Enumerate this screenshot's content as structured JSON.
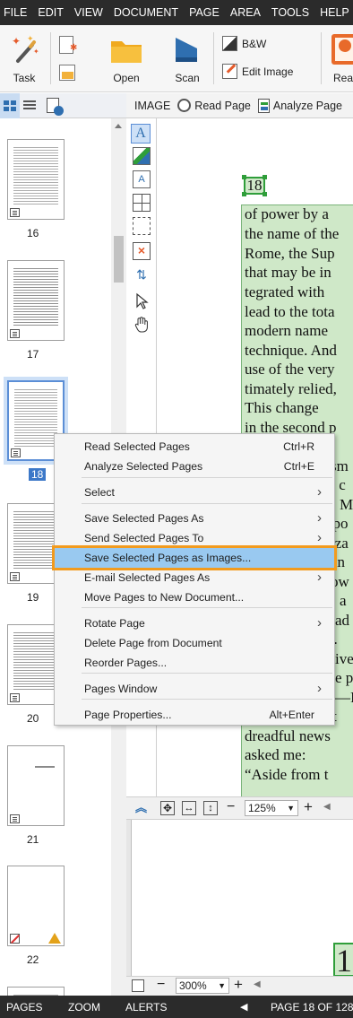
{
  "menubar": {
    "items": [
      "FILE",
      "EDIT",
      "VIEW",
      "DOCUMENT",
      "PAGE",
      "AREA",
      "TOOLS",
      "HELP"
    ]
  },
  "ribbon": {
    "task_label": "Task",
    "open_label": "Open",
    "scan_label": "Scan",
    "bw_label": "B&W",
    "edit_image_label": "Edit Image",
    "read_label": "Read"
  },
  "image_toolbar": {
    "image_label": "IMAGE",
    "read_page_label": "Read Page",
    "analyze_page_label": "Analyze Page"
  },
  "thumbnails": [
    {
      "num": "16",
      "selected": false
    },
    {
      "num": "17",
      "selected": false
    },
    {
      "num": "18",
      "selected": true
    },
    {
      "num": "19",
      "selected": false
    },
    {
      "num": "20",
      "selected": false
    },
    {
      "num": "21",
      "selected": false
    },
    {
      "num": "22",
      "selected": false,
      "warning": true
    }
  ],
  "document": {
    "page_number_zone": "18",
    "lines": [
      "of power by a",
      "the name of the",
      "Rome, the Sup",
      "that may be in",
      "tegrated with",
      "lead to the tota",
      "modern name",
      "technique. And",
      "use of the very",
      "timately relied,",
      "  This change",
      "in the second p",
      "n.",
      "sm",
      "on c",
      "M",
      "npo",
      "iza",
      "an",
      "ow",
      "n, a",
      "ad",
      "n.",
      "ive",
      "e p",
      "—I",
      "ing a conversat",
      "dreadful news",
      "asked me:",
      "  “Aside from t"
    ]
  },
  "view_toolbar": {
    "zoom_value": "125%"
  },
  "zoom_toolbar": {
    "zoom_value": "300%"
  },
  "zoom_view": {
    "digit": "1"
  },
  "context_menu": {
    "items": [
      {
        "label": "Read Selected Pages",
        "shortcut": "Ctrl+R"
      },
      {
        "label": "Analyze Selected Pages",
        "shortcut": "Ctrl+E"
      },
      {
        "label": "Select",
        "submenu": true
      },
      {
        "label": "Save Selected Pages As",
        "submenu": true
      },
      {
        "label": "Send Selected Pages To",
        "submenu": true
      },
      {
        "label": "Save Selected Pages as Images...",
        "highlighted": true
      },
      {
        "label": "E-mail Selected Pages As",
        "submenu": true
      },
      {
        "label": "Move Pages to New Document..."
      },
      {
        "label": "Rotate Page",
        "submenu": true
      },
      {
        "label": "Delete Page from Document"
      },
      {
        "label": "Reorder Pages..."
      },
      {
        "label": "Pages Window",
        "submenu": true
      },
      {
        "label": "Page Properties...",
        "shortcut": "Alt+Enter"
      }
    ]
  },
  "statusbar": {
    "pages_label": "PAGES",
    "zoom_label": "ZOOM",
    "alerts_label": "ALERTS",
    "page_indicator": "PAGE 18 OF 128"
  },
  "colors": {
    "menubar_bg": "#2b2b2b",
    "zone_green": "#cfe8c8",
    "zone_border": "#2f9e3a",
    "highlight_blue": "#99c9f0",
    "highlight_outline": "#f29b1e",
    "selected_thumb": "#3c78c8"
  }
}
